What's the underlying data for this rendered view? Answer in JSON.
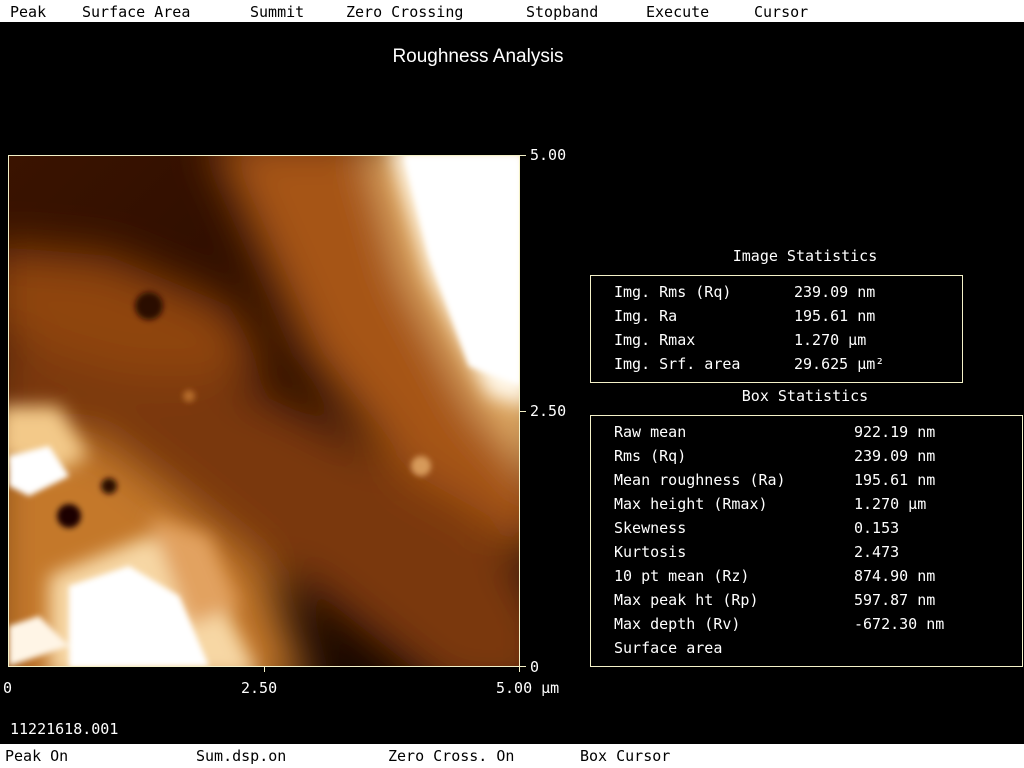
{
  "menu": [
    "Peak",
    "Surface Area",
    "Summit",
    "Zero Crossing",
    "Stopband",
    "Execute",
    "Cursor"
  ],
  "title": "Roughness Analysis",
  "axes": {
    "y_top": "5.00",
    "y_mid": "2.50",
    "y_bottom": "0",
    "x_left": "0",
    "x_mid": "2.50",
    "x_right": "5.00 µm"
  },
  "image_statistics": {
    "heading": "Image Statistics",
    "rows": [
      {
        "label": "Img. Rms (Rq)",
        "value": "239.09 nm"
      },
      {
        "label": "Img. Ra",
        "value": "195.61 nm"
      },
      {
        "label": "Img. Rmax",
        "value": "1.270 µm"
      },
      {
        "label": "Img. Srf. area",
        "value": "29.625 µm²"
      }
    ]
  },
  "box_statistics": {
    "heading": "Box Statistics",
    "rows": [
      {
        "label": "Raw mean",
        "value": "922.19 nm"
      },
      {
        "label": "Rms (Rq)",
        "value": "239.09 nm"
      },
      {
        "label": "Mean roughness (Ra)",
        "value": "195.61 nm"
      },
      {
        "label": "Max height (Rmax)",
        "value": "1.270 µm"
      },
      {
        "label": "Skewness",
        "value": "0.153"
      },
      {
        "label": "Kurtosis",
        "value": "2.473"
      },
      {
        "label": "10 pt mean (Rz)",
        "value": "874.90 nm"
      },
      {
        "label": "Max peak ht (Rp)",
        "value": "597.87 nm"
      },
      {
        "label": "Max depth (Rv)",
        "value": "-672.30 nm"
      },
      {
        "label": "Surface area",
        "value": ""
      }
    ]
  },
  "filename": "11221618.001",
  "status": [
    "Peak On",
    "Sum.dsp.on",
    "Zero Cross. On",
    "Box Cursor"
  ],
  "colors": {
    "background": "#000000",
    "bars": "#ffffff",
    "frame": "#f4f1c8",
    "afm_dark": "#120500",
    "afm_mid": "#8a3f0a",
    "afm_light": "#ffffff"
  }
}
